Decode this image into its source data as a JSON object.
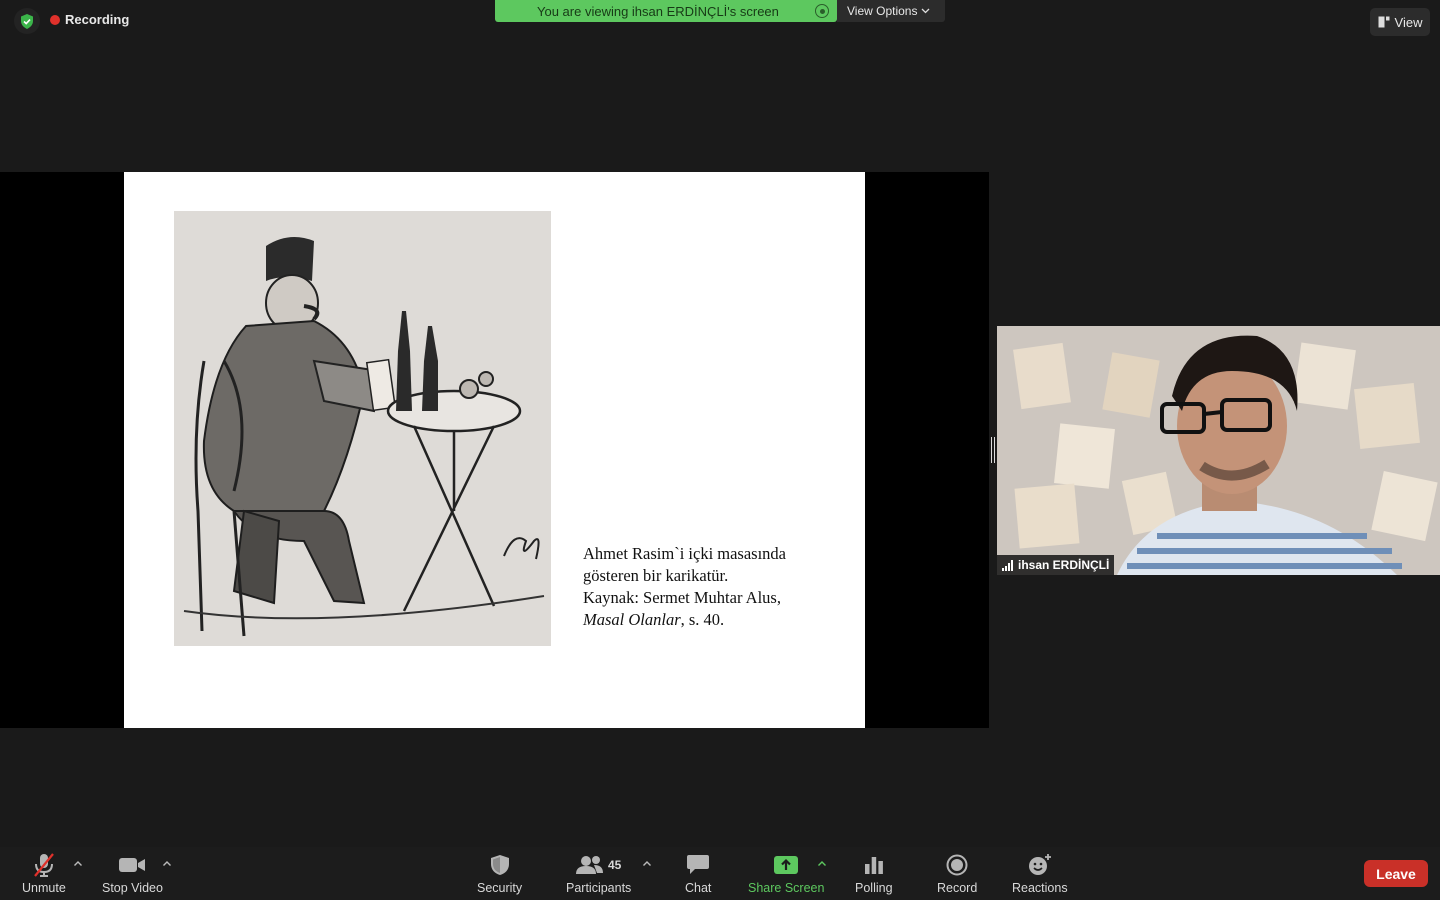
{
  "top_bar": {
    "recording_label": "Recording",
    "banner_text": "You are viewing ihsan ERDİNÇLİ's screen",
    "view_options_label": "View Options",
    "view_label": "View"
  },
  "slide": {
    "caption_line1": "Ahmet Rasim`i içki masasında",
    "caption_line2": "gösteren bir karikatür.",
    "caption_line3": "Kaynak: Sermet Muhtar Alus,",
    "caption_book": "Masal Olanlar",
    "caption_page": ", s. 40."
  },
  "video": {
    "participant_name": "ihsan ERDİNÇLİ"
  },
  "toolbar": {
    "unmute": "Unmute",
    "stop_video": "Stop Video",
    "security": "Security",
    "participants": "Participants",
    "participants_count": "45",
    "chat": "Chat",
    "share_screen": "Share Screen",
    "polling": "Polling",
    "record": "Record",
    "reactions": "Reactions",
    "leave": "Leave"
  },
  "colors": {
    "banner_green": "#5dc85f",
    "record_red": "#e0312b",
    "leave_red": "#c93028"
  }
}
